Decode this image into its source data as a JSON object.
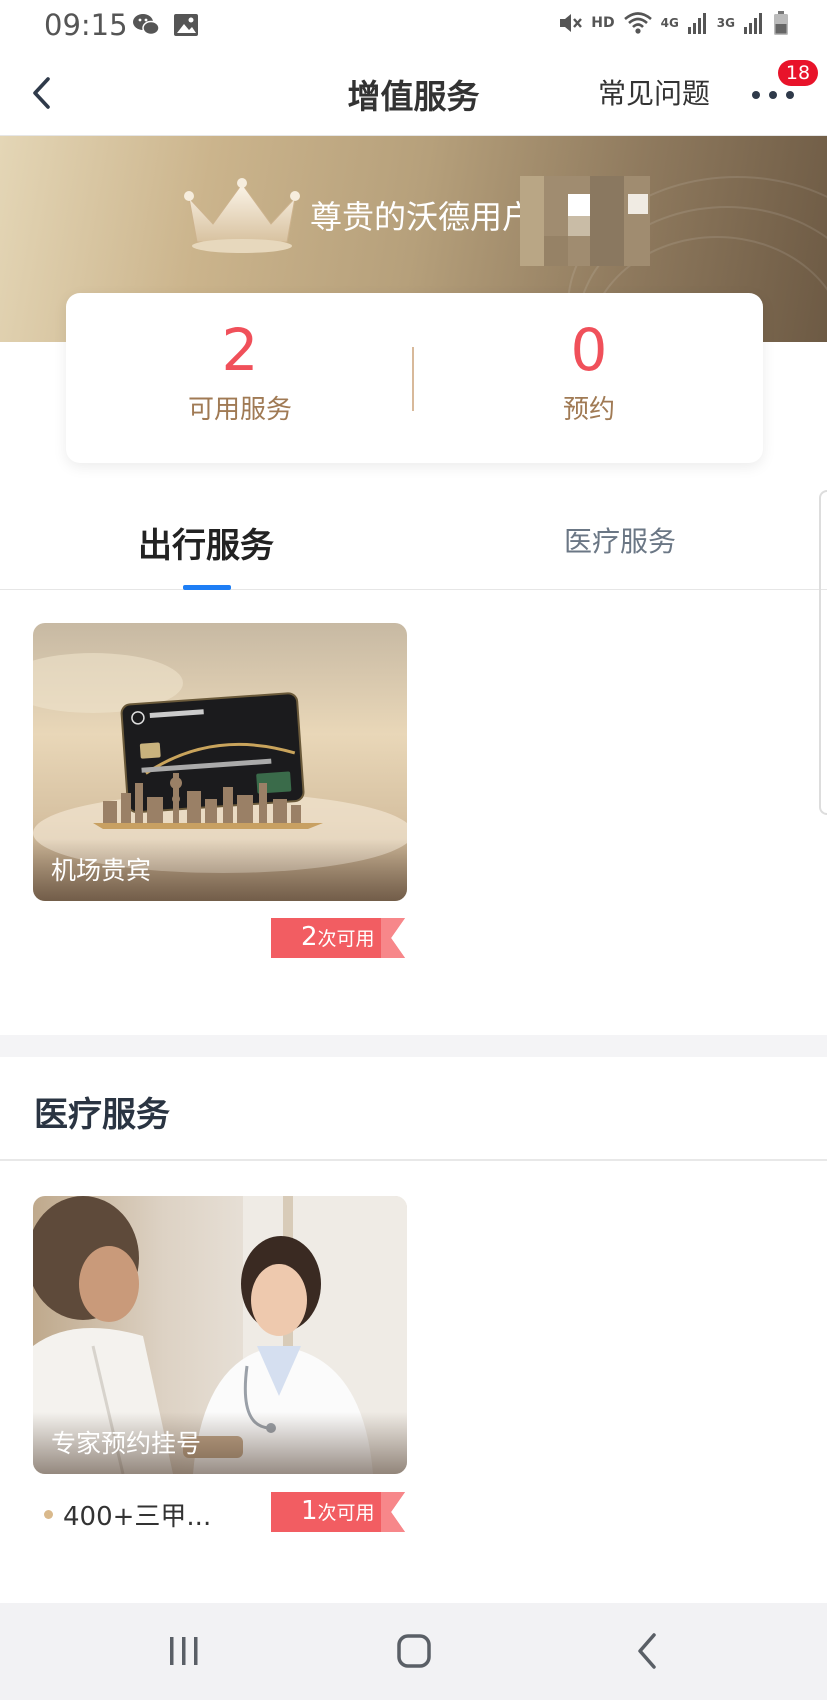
{
  "status_bar": {
    "time": "09:15",
    "icons": [
      "wechat-icon",
      "gallery-icon",
      "mute-icon",
      "wifi-icon",
      "signal-4g-icon",
      "signal-3g-icon",
      "battery-icon"
    ],
    "hd": "HD",
    "net_4g": "4G",
    "net_3g": "3G"
  },
  "header": {
    "title": "增值服务",
    "faq": "常见问题",
    "notification_count": "18"
  },
  "hero": {
    "greeting": "尊贵的沃德用户"
  },
  "stats": {
    "available_value": "2",
    "available_label": "可用服务",
    "booking_value": "0",
    "booking_label": "预约"
  },
  "tabs": [
    {
      "label": "出行服务",
      "active": true
    },
    {
      "label": "医疗服务",
      "active": false
    }
  ],
  "travel_services": [
    {
      "label": "机场贵宾",
      "count": "2",
      "unit": "次可用"
    }
  ],
  "medical_section": {
    "title": "医疗服务",
    "services": [
      {
        "label": "专家预约挂号",
        "count": "1",
        "unit": "次可用",
        "note": "400+三甲..."
      }
    ]
  },
  "colors": {
    "accent_red": "#f0505a",
    "tab_indicator": "#1e7ef5",
    "gold_text": "#a07a54",
    "badge_red": "#e8132a"
  }
}
